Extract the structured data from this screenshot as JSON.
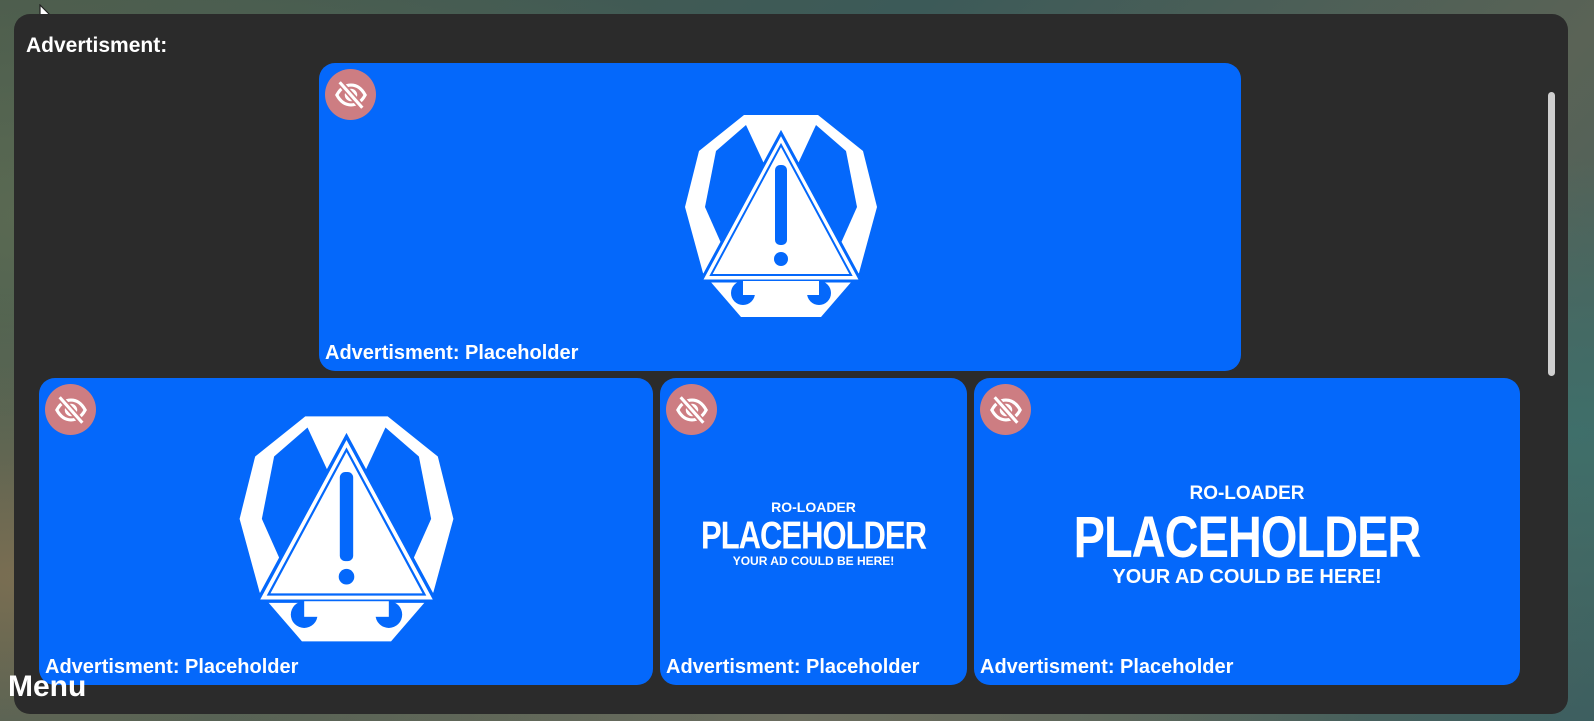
{
  "panel": {
    "title": "Advertisment:"
  },
  "ads": [
    {
      "caption": "Advertisment: Placeholder",
      "kind": "warning-logo"
    },
    {
      "caption": "Advertisment: Placeholder",
      "kind": "warning-logo"
    },
    {
      "caption": "Advertisment: Placeholder",
      "kind": "text-placeholder",
      "top": "RO-LOADER",
      "main": "PLACEHOLDER",
      "sub": "YOUR AD COULD BE HERE!"
    },
    {
      "caption": "Advertisment: Placeholder",
      "kind": "text-placeholder",
      "top": "RO-LOADER",
      "main": "PLACEHOLDER",
      "sub": "YOUR AD COULD BE HERE!"
    }
  ],
  "footer": {
    "menu_label": "Menu"
  },
  "colors": {
    "card": "#0468fb",
    "panel": "#2b2b2b",
    "hide_button": "#cd7d82"
  },
  "icons": {
    "hide": "eye-slash-icon",
    "ad_logo": "warning-octagon-icon"
  }
}
